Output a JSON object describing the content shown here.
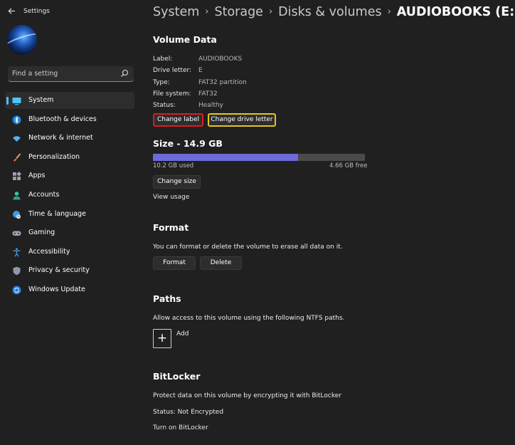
{
  "window": {
    "title": "Settings"
  },
  "search": {
    "placeholder": "Find a setting"
  },
  "sidebar": {
    "items": [
      {
        "label": "System",
        "icon": "system-monitor-icon",
        "selected": true
      },
      {
        "label": "Bluetooth & devices",
        "icon": "bluetooth-icon"
      },
      {
        "label": "Network & internet",
        "icon": "wifi-icon"
      },
      {
        "label": "Personalization",
        "icon": "paintbrush-icon"
      },
      {
        "label": "Apps",
        "icon": "apps-icon"
      },
      {
        "label": "Accounts",
        "icon": "person-icon"
      },
      {
        "label": "Time & language",
        "icon": "globe-clock-icon"
      },
      {
        "label": "Gaming",
        "icon": "gamepad-icon"
      },
      {
        "label": "Accessibility",
        "icon": "accessibility-icon"
      },
      {
        "label": "Privacy & security",
        "icon": "shield-icon"
      },
      {
        "label": "Windows Update",
        "icon": "update-icon"
      }
    ]
  },
  "breadcrumb": {
    "items": [
      "System",
      "Storage",
      "Disks & volumes"
    ],
    "current": "AUDIOBOOKS (E:)"
  },
  "volume_data": {
    "title": "Volume Data",
    "rows": [
      {
        "key": "Label:",
        "value": "AUDIOBOOKS"
      },
      {
        "key": "Drive letter:",
        "value": "E"
      },
      {
        "key": "Type:",
        "value": "FAT32 partition"
      },
      {
        "key": "File system:",
        "value": "FAT32"
      },
      {
        "key": "Status:",
        "value": "Healthy"
      }
    ],
    "change_label_button": "Change label",
    "change_drive_letter_button": "Change drive letter",
    "highlight_colors": {
      "change_label": "#e0191d",
      "change_drive_letter": "#e6c51b"
    }
  },
  "size": {
    "title": "Size - 14.9 GB",
    "used_label": "10.2 GB used",
    "free_label": "4.66 GB free",
    "used_fraction": 0.686,
    "bar_color": "#6d6bd9",
    "change_size_button": "Change size",
    "view_usage_link": "View usage"
  },
  "format": {
    "title": "Format",
    "description": "You can format or delete the volume to erase all data on it.",
    "format_button": "Format",
    "delete_button": "Delete"
  },
  "paths": {
    "title": "Paths",
    "description": "Allow access to this volume using the following NTFS paths.",
    "add_label": "Add"
  },
  "bitlocker": {
    "title": "BitLocker",
    "description": "Protect data on this volume by encrypting it with BitLocker",
    "status": "Status: Not Encrypted",
    "turn_on_link": "Turn on BitLocker"
  }
}
